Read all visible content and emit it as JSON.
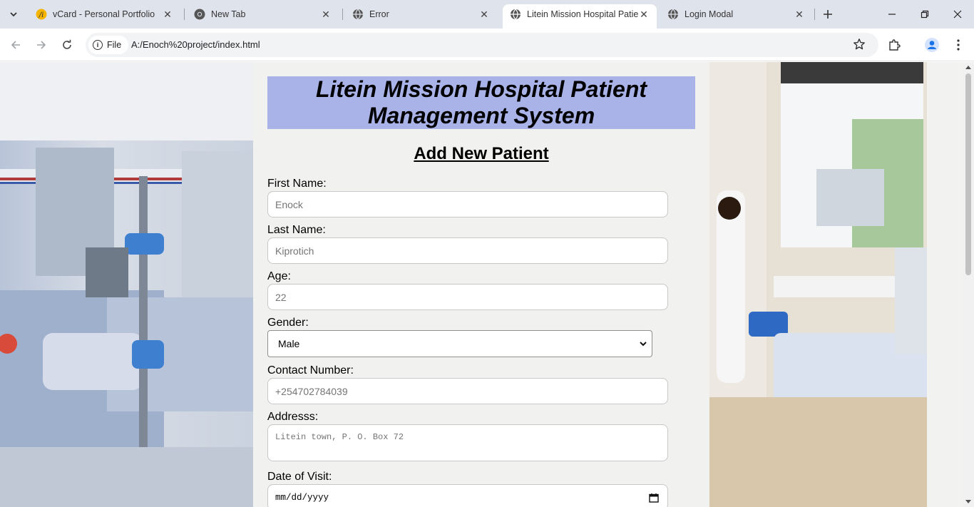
{
  "browser": {
    "tabs": [
      {
        "title": "vCard - Personal Portfolio",
        "icon": "vcard-favicon"
      },
      {
        "title": "New Tab",
        "icon": "chrome-icon"
      },
      {
        "title": "Error",
        "icon": "globe-icon"
      },
      {
        "title": "Litein Mission Hospital Patie",
        "icon": "globe-icon",
        "active": true
      },
      {
        "title": "Login Modal",
        "icon": "globe-icon"
      }
    ],
    "chip_label": "File",
    "url": "A:/Enoch%20project/index.html"
  },
  "page": {
    "header": "Litein Mission Hospital Patient Management System",
    "heading": "Add New Patient",
    "form": {
      "first_name_label": "First Name:",
      "first_name_placeholder": "Enock",
      "last_name_label": "Last Name:",
      "last_name_placeholder": "Kiprotich",
      "age_label": "Age:",
      "age_placeholder": "22",
      "gender_label": "Gender:",
      "gender_value": "Male",
      "contact_label": "Contact Number:",
      "contact_placeholder": "+254702784039",
      "address_label": "Addresss:",
      "address_placeholder": "Litein town, P. O. Box 72",
      "date_label": "Date of Visit:",
      "date_value": "mm/dd/yyyy"
    }
  },
  "colors": {
    "header_bg": "#a9b3e8",
    "tabstrip_bg": "#dfe3eb",
    "profile_accent": "#1a73e8"
  }
}
